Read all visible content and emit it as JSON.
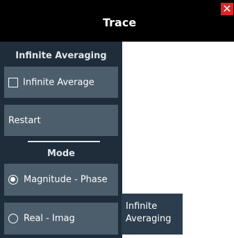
{
  "dialog": {
    "title": "Trace",
    "close_symbol": "✕"
  },
  "infinite_averaging": {
    "section_label": "Infinite Averaging",
    "checkbox_label": "Infinite Average",
    "restart_label": "Restart"
  },
  "mode": {
    "section_label": "Mode",
    "options": [
      {
        "label": "Magnitude - Phase",
        "selected": true
      },
      {
        "label": "Real - Imag",
        "selected": false
      }
    ]
  },
  "tooltip": {
    "line1": "Infinite",
    "line2": "Averaging"
  },
  "colors": {
    "title_bar": "#000000",
    "panel": "#1f2d3a",
    "button": "#4c5e6c",
    "close": "#e22222"
  }
}
